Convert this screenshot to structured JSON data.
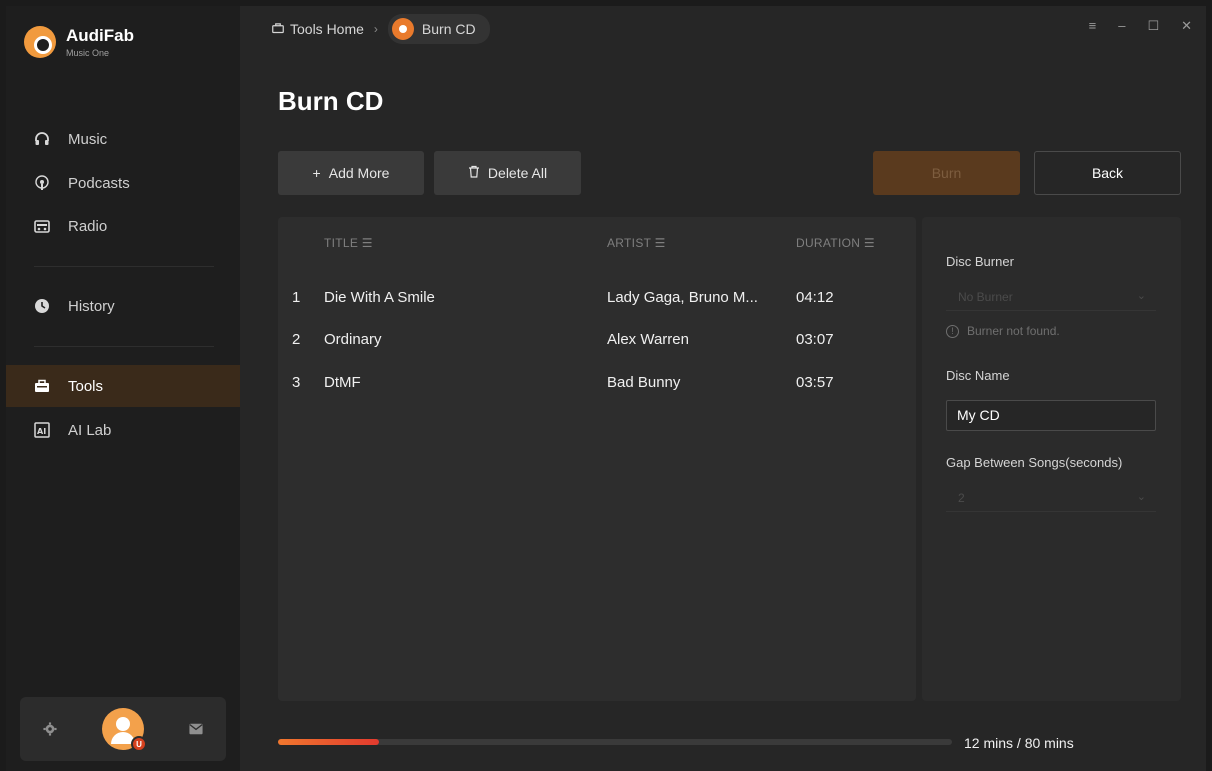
{
  "brand": {
    "name": "AudiFab",
    "subtitle": "Music One"
  },
  "sidebar": {
    "items": [
      {
        "label": "Music",
        "icon": "headphones-icon"
      },
      {
        "label": "Podcasts",
        "icon": "podcast-icon"
      },
      {
        "label": "Radio",
        "icon": "radio-icon"
      },
      {
        "label": "History",
        "icon": "clock-icon"
      },
      {
        "label": "Tools",
        "icon": "toolbox-icon",
        "active": true
      },
      {
        "label": "AI Lab",
        "icon": "ai-icon"
      }
    ],
    "footer": {
      "settings_icon": "gear-icon",
      "avatar_badge": "U",
      "mail_icon": "mail-icon"
    }
  },
  "breadcrumb": {
    "home": "Tools Home",
    "current": "Burn CD"
  },
  "page": {
    "title": "Burn CD"
  },
  "toolbar": {
    "add_more": "Add More",
    "delete_all": "Delete All",
    "burn": "Burn",
    "back": "Back"
  },
  "table": {
    "columns": [
      "TITLE",
      "ARTIST",
      "DURATION"
    ],
    "rows": [
      {
        "index": "1",
        "title": "Die With A Smile",
        "artist": "Lady Gaga, Bruno M...",
        "duration": "04:12"
      },
      {
        "index": "2",
        "title": "Ordinary",
        "artist": "Alex Warren",
        "duration": "03:07"
      },
      {
        "index": "3",
        "title": "DtMF",
        "artist": "Bad Bunny",
        "duration": "03:57"
      }
    ]
  },
  "settings": {
    "disc_burner_label": "Disc Burner",
    "disc_burner_value": "No Burner",
    "burner_warning": "Burner not found.",
    "disc_name_label": "Disc Name",
    "disc_name_value": "My CD",
    "gap_label": "Gap Between Songs(seconds)",
    "gap_value": "2"
  },
  "progress": {
    "text": "12 mins / 80 mins",
    "fraction": 0.15
  },
  "colors": {
    "accent": "#f0772e",
    "active_bg": "#3a2a1a",
    "burn_disabled": "#5a3a1e"
  }
}
